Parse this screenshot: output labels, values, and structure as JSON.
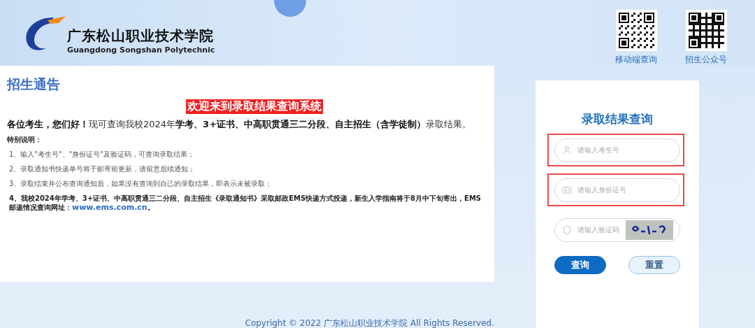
{
  "header": {
    "school_name": "广东松山职业技术学院",
    "school_name_en": "Guangdong Songshan Polytechnic",
    "qr_codes": [
      {
        "label": "移动端查询"
      },
      {
        "label": "招生公众号"
      }
    ]
  },
  "notice": {
    "title": "招生通告",
    "banner": "欢迎来到录取结果查询系统",
    "greeting": "**各位考生，您们好！**现可查询我校2024年**学考、3+证书、中高职贯通三二分段、自主招生（含学徒制）**录取结果。",
    "note_title": "特别说明：",
    "items": [
      "1、输入\"考生号\"、\"身份证号\"及验证码，可查询录取结果；",
      "2、录取通知书快递单号将于邮寄前更新，请留意后续通知；",
      "3、录取结束并公布查询通知后，如果没有查询到自己的录取结果，即表示未被录取；"
    ],
    "final_item": {
      "text": "4、我校2024年学考、3+证书、中高职贯通三二分段、自主招生《录取通知书》采取邮政EMS快递方式投递，新生入学指南将于8月中下旬寄出，EMS邮递情况查询网址：",
      "link": "www.ems.com.cn",
      "end": "。"
    }
  },
  "login": {
    "title": "录取结果查询",
    "fields": [
      {
        "kind": "user",
        "placeholder": "请输入考生号",
        "highlighted": true
      },
      {
        "kind": "id",
        "placeholder": "请输入身份证号",
        "highlighted": true
      },
      {
        "kind": "captcha",
        "placeholder": "请输入验证码",
        "highlighted": false
      }
    ],
    "buttons": [
      {
        "label": "查询",
        "kind": "primary"
      },
      {
        "label": "重置",
        "kind": "secondary"
      }
    ]
  },
  "footer": {
    "copyright": "Copyright © 2022 广东松山职业技术学院 All Rights Reserved."
  }
}
